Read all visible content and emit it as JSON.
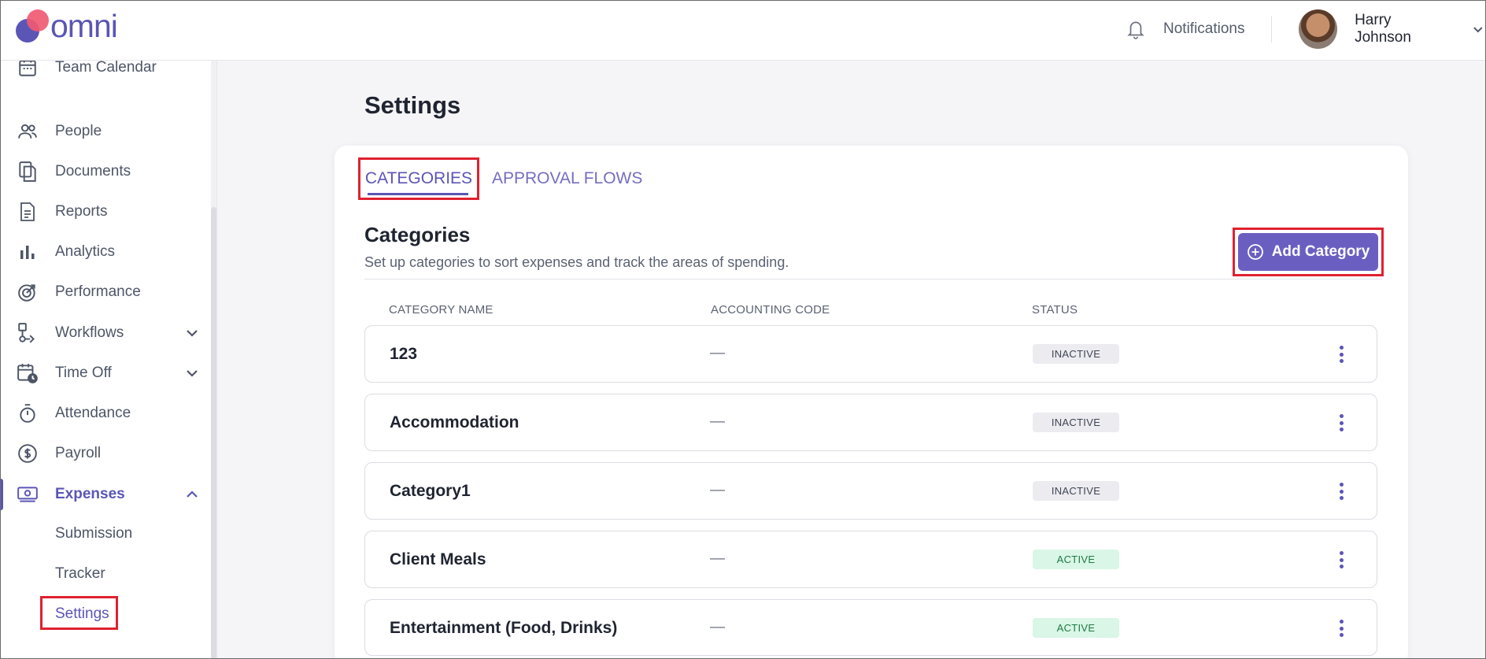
{
  "app": {
    "logo_text": "omni",
    "brand_color": "#5b55b6",
    "logo_accent": "#f05a72"
  },
  "header": {
    "notifications_label": "Notifications",
    "user_name": "Harry Johnson"
  },
  "sidebar": {
    "items": [
      {
        "label": "Team Calendar",
        "icon": "calendar-icon"
      },
      {
        "label": "People",
        "icon": "people-icon"
      },
      {
        "label": "Documents",
        "icon": "documents-icon"
      },
      {
        "label": "Reports",
        "icon": "report-icon"
      },
      {
        "label": "Analytics",
        "icon": "bar-chart-icon"
      },
      {
        "label": "Performance",
        "icon": "target-icon"
      },
      {
        "label": "Workflows",
        "icon": "workflow-icon"
      },
      {
        "label": "Time Off",
        "icon": "calendar-clock-icon"
      },
      {
        "label": "Attendance",
        "icon": "stopwatch-icon"
      },
      {
        "label": "Payroll",
        "icon": "dollar-icon"
      },
      {
        "label": "Expenses",
        "icon": "money-icon"
      }
    ],
    "expenses_sub": [
      {
        "label": "Submission"
      },
      {
        "label": "Tracker"
      },
      {
        "label": "Settings"
      }
    ]
  },
  "main": {
    "page_title": "Settings",
    "tabs": [
      {
        "label": "CATEGORIES"
      },
      {
        "label": "APPROVAL FLOWS"
      }
    ],
    "section_title": "Categories",
    "section_desc": "Set up categories to sort expenses and track the areas of spending.",
    "add_button_label": "Add Category",
    "columns": [
      "CATEGORY NAME",
      "ACCOUNTING CODE",
      "STATUS"
    ],
    "rows": [
      {
        "name": "123",
        "code": "—",
        "status": "INACTIVE"
      },
      {
        "name": "Accommodation",
        "code": "—",
        "status": "INACTIVE"
      },
      {
        "name": "Category1",
        "code": "—",
        "status": "INACTIVE"
      },
      {
        "name": "Client Meals",
        "code": "—",
        "status": "ACTIVE"
      },
      {
        "name": "Entertainment (Food, Drinks)",
        "code": "—",
        "status": "ACTIVE"
      }
    ]
  }
}
